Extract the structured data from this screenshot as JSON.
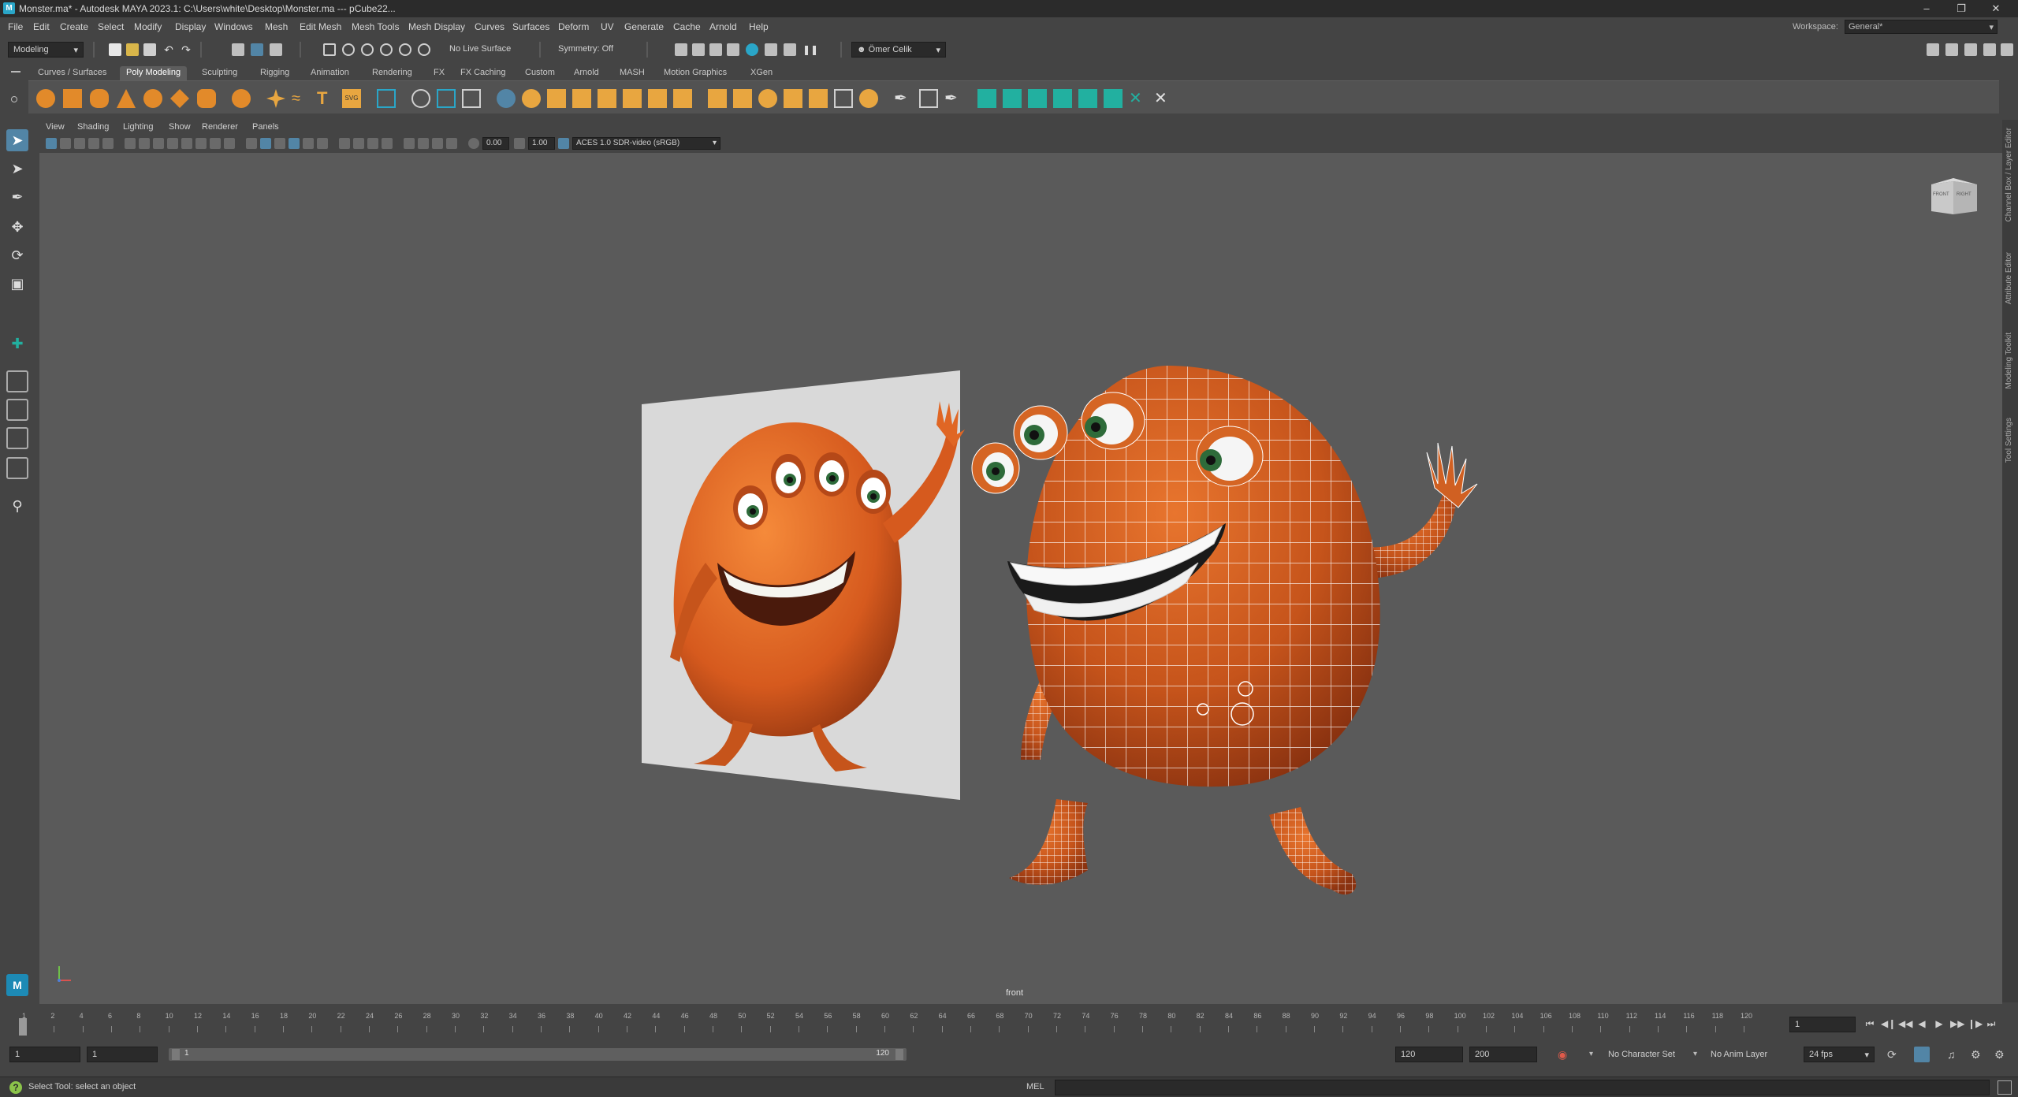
{
  "window": {
    "title": "Monster.ma* - Autodesk MAYA 2023.1: C:\\Users\\white\\Desktop\\Monster.ma  ---  pCube22..."
  },
  "menubar": {
    "items": [
      "File",
      "Edit",
      "Create",
      "Select",
      "Modify",
      "Display",
      "Windows",
      "Mesh",
      "Edit Mesh",
      "Mesh Tools",
      "Mesh Display",
      "Curves",
      "Surfaces",
      "Deform",
      "UV",
      "Generate",
      "Cache",
      "Arnold",
      "Help"
    ],
    "workspace_label": "Workspace:",
    "workspace_value": "General*"
  },
  "statusline": {
    "menuset": "Modeling",
    "live_surface": "No Live Surface",
    "symmetry": "Symmetry: Off",
    "user": "Ömer Celik"
  },
  "shelf": {
    "tabs": [
      "Curves / Surfaces",
      "Poly Modeling",
      "Sculpting",
      "Rigging",
      "Animation",
      "Rendering",
      "FX",
      "FX Caching",
      "Custom",
      "Arnold",
      "MASH",
      "Motion Graphics",
      "XGen"
    ],
    "active_tab": "Poly Modeling"
  },
  "panel": {
    "menus": [
      "View",
      "Shading",
      "Lighting",
      "Show",
      "Renderer",
      "Panels"
    ],
    "exposure": "0.00",
    "gamma": "1.00",
    "color_space": "ACES 1.0 SDR-video (sRGB)",
    "camera": "front",
    "viewcube_left": "FRONT",
    "viewcube_right": "RIGHT"
  },
  "right_tabs": [
    "Channel Box / Layer Editor",
    "Attribute Editor",
    "Modeling Toolkit",
    "Tool Settings"
  ],
  "timeline": {
    "ticks": [
      "1",
      "2",
      "4",
      "6",
      "8",
      "10",
      "12",
      "14",
      "16",
      "18",
      "20",
      "22",
      "24",
      "26",
      "28",
      "30",
      "32",
      "34",
      "36",
      "38",
      "40",
      "42",
      "44",
      "46",
      "48",
      "50",
      "52",
      "54",
      "56",
      "58",
      "60",
      "62",
      "64",
      "66",
      "68",
      "70",
      "72",
      "74",
      "76",
      "78",
      "80",
      "82",
      "84",
      "86",
      "88",
      "90",
      "92",
      "94",
      "96",
      "98",
      "100",
      "102",
      "104",
      "106",
      "108",
      "110",
      "112",
      "114",
      "116",
      "118",
      "120"
    ],
    "current_frame": "1"
  },
  "range": {
    "start": "1",
    "playback_start": "1",
    "slider_start": "1",
    "slider_end": "120",
    "playback_end": "120",
    "end": "200",
    "character_set": "No Character Set",
    "anim_layer": "No Anim Layer",
    "fps": "24 fps"
  },
  "cmdline": {
    "language": "MEL",
    "help": "Select Tool: select an object"
  },
  "colors": {
    "monster_orange": "#c6541b",
    "wire": "#ffffff",
    "select_blue": "#5285a6",
    "viewport_bg": "#5a5a5a"
  }
}
